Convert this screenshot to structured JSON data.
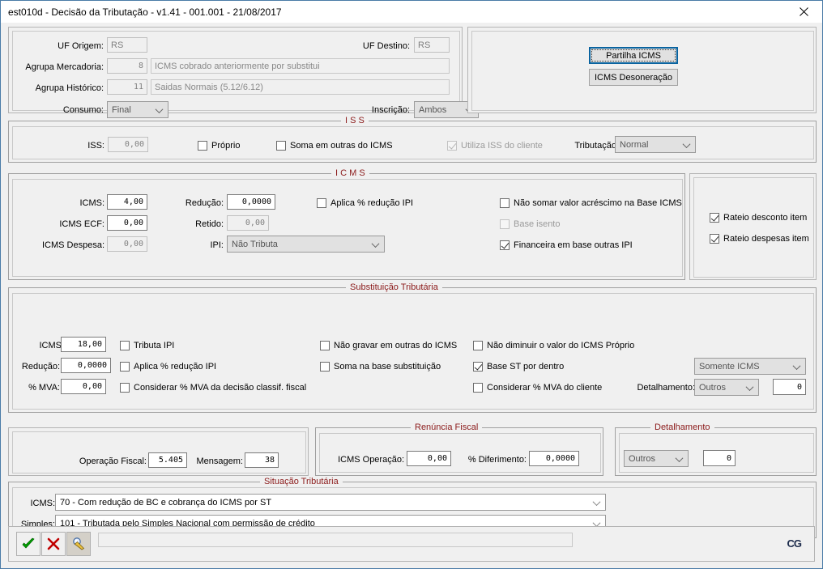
{
  "window": {
    "title": "est010d - Decisão da Tributação - v1.41 - 001.001 - 21/08/2017",
    "close_icon": "close-icon"
  },
  "header": {
    "uf_origem_label": "UF Origem:",
    "uf_origem_value": "RS",
    "uf_destino_label": "UF Destino:",
    "uf_destino_value": "RS",
    "agrupa_mercadoria_label": "Agrupa Mercadoria:",
    "agrupa_mercadoria_code": "8",
    "agrupa_mercadoria_desc": "ICMS cobrado anteriormente por substitui",
    "agrupa_historico_label": "Agrupa Histórico:",
    "agrupa_historico_code": "11",
    "agrupa_historico_desc": "Saidas Normais (5.12/6.12)",
    "consumo_label": "Consumo:",
    "consumo_value": "Final",
    "inscricao_label": "Inscrição:",
    "inscricao_value": "Ambos",
    "partilha_button": "Partilha ICMS",
    "desoneracao_button": "ICMS Desoneração"
  },
  "iss": {
    "caption": "I S S",
    "iss_label": "ISS:",
    "iss_value": "0,00",
    "proprio_label": "Próprio",
    "proprio_checked": false,
    "soma_outras_label": "Soma em outras do ICMS",
    "soma_outras_checked": false,
    "utiliza_iss_label": "Utiliza ISS do cliente",
    "utiliza_iss_checked": true,
    "tributacao_label": "Tributação:",
    "tributacao_value": "Normal"
  },
  "icms": {
    "caption": "I C M S",
    "icms_label": "ICMS:",
    "icms_value": "4,00",
    "icms_ecf_label": "ICMS ECF:",
    "icms_ecf_value": "0,00",
    "icms_despesa_label": "ICMS Despesa:",
    "icms_despesa_value": "0,00",
    "reducao_label": "Redução:",
    "reducao_value": "0,0000",
    "retido_label": "Retido:",
    "retido_value": "0,00",
    "ipi_label": "IPI:",
    "ipi_value": "Não Tributa",
    "aplica_reducao_label": "Aplica % redução IPI",
    "aplica_reducao_checked": false,
    "nao_somar_label": "Não somar valor acréscimo na Base ICMS",
    "nao_somar_checked": false,
    "base_isento_label": "Base isento",
    "base_isento_checked": false,
    "financeira_label": "Financeira em base outras IPI",
    "financeira_checked": true
  },
  "rateio": {
    "desconto_label": "Rateio desconto item",
    "desconto_checked": true,
    "despesas_label": "Rateio despesas item",
    "despesas_checked": true
  },
  "substituicao": {
    "caption": "Substituição Tributária",
    "icms_label": "ICMS:",
    "icms_value": "18,00",
    "reducao_label": "Redução:",
    "reducao_value": "0,0000",
    "mva_label": "% MVA:",
    "mva_value": "0,00",
    "tributa_ipi_label": "Tributa IPI",
    "tributa_ipi_checked": false,
    "aplica_reducao_label": "Aplica % redução IPI",
    "aplica_reducao_checked": false,
    "considerar_mva_decisao_label": "Considerar % MVA da decisão classif. fiscal",
    "considerar_mva_decisao_checked": false,
    "nao_gravar_label": "Não gravar em outras do ICMS",
    "nao_gravar_checked": false,
    "soma_base_label": "Soma na base substituição",
    "soma_base_checked": false,
    "nao_diminuir_label": "Não diminuir o valor do ICMS Próprio",
    "nao_diminuir_checked": false,
    "base_st_label": "Base ST por dentro",
    "base_st_checked": true,
    "considerar_mva_cliente_label": "Considerar % MVA do cliente",
    "considerar_mva_cliente_checked": false,
    "somente_icms_value": "Somente ICMS",
    "detalhamento_label": "Detalhamento:",
    "detalhamento_value": "Outros",
    "detalhamento_code": "0"
  },
  "operacao": {
    "operacao_fiscal_label": "Operação Fiscal:",
    "operacao_fiscal_value": "5.405",
    "mensagem_label": "Mensagem:",
    "mensagem_value": "38"
  },
  "renuncia": {
    "caption": "Renúncia Fiscal",
    "icms_operacao_label": "ICMS Operação:",
    "icms_operacao_value": "0,00",
    "diferimento_label": "% Diferimento:",
    "diferimento_value": "0,0000"
  },
  "detalhamento": {
    "caption": "Detalhamento",
    "combo_value": "Outros",
    "code_value": "0"
  },
  "situacao": {
    "caption": "Situação Tributária",
    "icms_label": "ICMS:",
    "icms_value": "70 - Com redução de BC e cobrança do ICMS por ST",
    "simples_label": "Simples:",
    "simples_value": "101 - Tributada pelo Simples Nacional com permissão de crédito"
  },
  "toolbar": {
    "confirm_icon": "check-icon",
    "cancel_icon": "cancel-icon",
    "search_icon": "magnifier-pencil-icon",
    "status_text": "",
    "logo_text": "CG"
  }
}
